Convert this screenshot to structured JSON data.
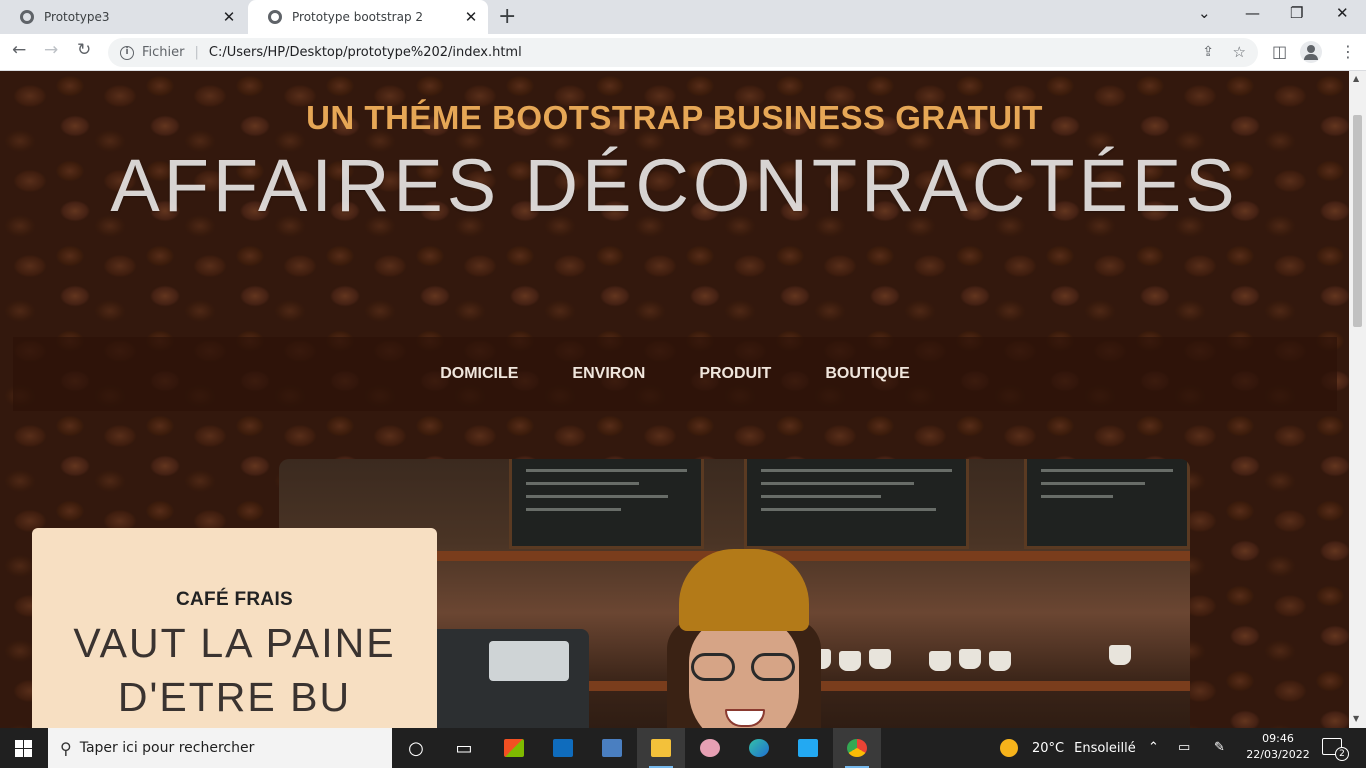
{
  "browser": {
    "tabs": [
      {
        "title": "Prototype3",
        "active": false
      },
      {
        "title": "Prototype bootstrap 2",
        "active": true
      }
    ],
    "new_tab": "+",
    "address": {
      "scheme_label": "Fichier",
      "separator": "|",
      "url": "C:/Users/HP/Desktop/prototype%202/index.html"
    }
  },
  "page": {
    "subtitle": "UN THÉME BOOTSTRAP BUSINESS GRATUIT",
    "title": "AFFAIRES DÉCONTRACTÉES",
    "nav": [
      {
        "label": "DOMICILE"
      },
      {
        "label": "ENVIRON"
      },
      {
        "label": "PRODUIT"
      },
      {
        "label": "BOUTIQUE"
      }
    ],
    "card": {
      "kicker": "CAFÉ FRAIS",
      "headline_line1": "VAUT LA PAINE",
      "headline_line2": "D'ETRE BU"
    },
    "colors": {
      "subtitle": "#e6a756",
      "card_bg": "#f7dfc2",
      "nav_bg": "#2d1208"
    }
  },
  "taskbar": {
    "search_placeholder": "Taper ici pour rechercher",
    "pinned": [
      "cortana-icon",
      "task-view-icon",
      "microsoft-store-icon",
      "mail-icon",
      "remote-desktop-icon",
      "file-explorer-icon",
      "paint-icon",
      "edge-icon",
      "vscode-icon",
      "chrome-icon"
    ],
    "weather": {
      "temp": "20°C",
      "condition": "Ensoleillé"
    },
    "time": "09:46",
    "date": "22/03/2022",
    "notifications": "2"
  }
}
